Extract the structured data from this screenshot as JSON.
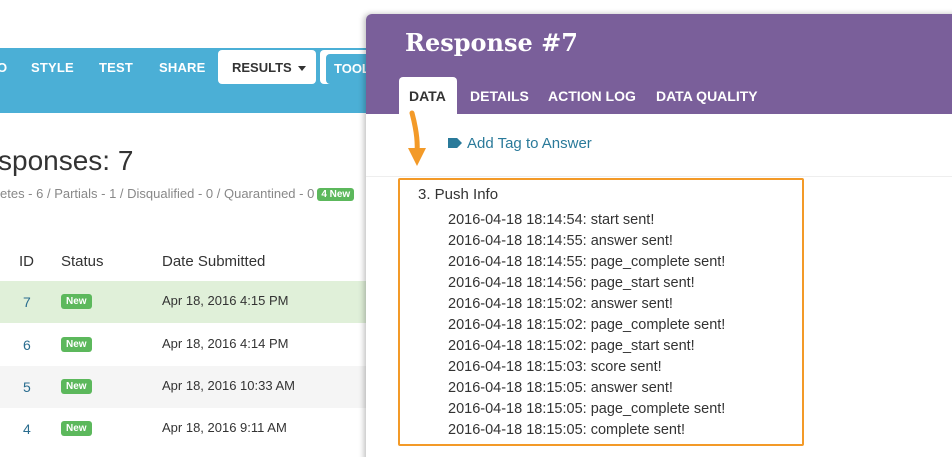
{
  "top_nav": {
    "items": [
      {
        "label": "O"
      },
      {
        "label": "STYLE"
      },
      {
        "label": "TEST"
      },
      {
        "label": "SHARE"
      }
    ],
    "results_label": "RESULTS",
    "tools_label": "TOOL"
  },
  "responses": {
    "title": "sponses: 7",
    "summary": "etes - 6 / Partials - 1 / Disqualified - 0 / Quarantined - 0",
    "new_chip": "4 New",
    "columns": {
      "id": "ID",
      "status": "Status",
      "date": "Date Submitted"
    },
    "rows": [
      {
        "id": "7",
        "status": "New",
        "date": "Apr 18, 2016 4:15 PM"
      },
      {
        "id": "6",
        "status": "New",
        "date": "Apr 18, 2016 4:14 PM"
      },
      {
        "id": "5",
        "status": "New",
        "date": "Apr 18, 2016 10:33 AM"
      },
      {
        "id": "4",
        "status": "New",
        "date": "Apr 18, 2016 9:11 AM"
      }
    ]
  },
  "modal": {
    "title": "Response #7",
    "tabs": [
      "DATA",
      "DETAILS",
      "ACTION LOG",
      "DATA QUALITY"
    ],
    "tag_link": "Add Tag to Answer",
    "question": "3. Push Info",
    "log": [
      "2016-04-18 18:14:54: start sent!",
      "2016-04-18 18:14:55: answer sent!",
      "2016-04-18 18:14:55: page_complete sent!",
      "2016-04-18 18:14:56: page_start sent!",
      "2016-04-18 18:15:02: answer sent!",
      "2016-04-18 18:15:02: page_complete sent!",
      "2016-04-18 18:15:02: page_start sent!",
      "2016-04-18 18:15:03: score sent!",
      "2016-04-18 18:15:05: answer sent!",
      "2016-04-18 18:15:05: page_complete sent!",
      "2016-04-18 18:15:05: complete sent!"
    ]
  },
  "colors": {
    "nav_blue": "#4bafd6",
    "modal_purple": "#7a5f9a",
    "highlight_orange": "#f39a28",
    "new_green": "#5cb85c",
    "link_teal": "#2a7a9a"
  }
}
